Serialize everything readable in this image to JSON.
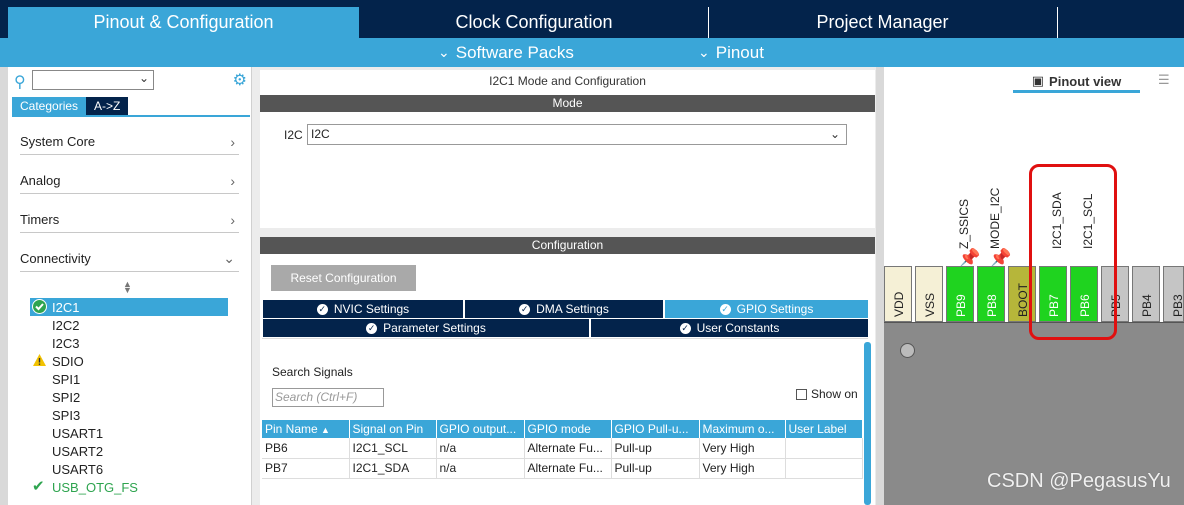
{
  "top_tabs": [
    "Pinout & Configuration",
    "Clock Configuration",
    "Project Manager"
  ],
  "sub_menu": [
    "Software Packs",
    "Pinout"
  ],
  "left": {
    "category_tabs": [
      "Categories",
      "A->Z"
    ],
    "categories": [
      "System Core",
      "Analog",
      "Timers",
      "Connectivity"
    ],
    "items": [
      {
        "label": "I2C1",
        "status": "ok"
      },
      {
        "label": "I2C2",
        "status": ""
      },
      {
        "label": "I2C3",
        "status": ""
      },
      {
        "label": "SDIO",
        "status": "warn"
      },
      {
        "label": "SPI1",
        "status": ""
      },
      {
        "label": "SPI2",
        "status": ""
      },
      {
        "label": "SPI3",
        "status": ""
      },
      {
        "label": "USART1",
        "status": ""
      },
      {
        "label": "USART2",
        "status": ""
      },
      {
        "label": "USART6",
        "status": ""
      },
      {
        "label": "USB_OTG_FS",
        "status": "ok"
      }
    ]
  },
  "middle": {
    "title": "I2C1 Mode and Configuration",
    "mode_header": "Mode",
    "i2c_label": "I2C",
    "i2c_value": "I2C",
    "config_header": "Configuration",
    "reset_button": "Reset Configuration",
    "settings_tabs_row1": [
      "NVIC Settings",
      "DMA Settings",
      "GPIO Settings"
    ],
    "settings_tabs_row2": [
      "Parameter Settings",
      "User Constants"
    ],
    "search_label": "Search Signals",
    "search_placeholder": "Search (Ctrl+F)",
    "show_on": "Show on",
    "table": {
      "headers": [
        "Pin Name",
        "Signal on Pin",
        "GPIO output...",
        "GPIO mode",
        "GPIO Pull-u...",
        "Maximum o...",
        "User Label"
      ],
      "rows": [
        [
          "PB6",
          "I2C1_SCL",
          "n/a",
          "Alternate Fu...",
          "Pull-up",
          "Very High",
          ""
        ],
        [
          "PB7",
          "I2C1_SDA",
          "n/a",
          "Alternate Fu...",
          "Pull-up",
          "Very High",
          ""
        ]
      ]
    }
  },
  "right": {
    "pinout_view": "Pinout view",
    "signals": [
      "Z_SSICS",
      "MODE_I2C",
      "I2C1_SDA",
      "I2C1_SCL"
    ],
    "pins": [
      "VDD",
      "VSS",
      "PB9",
      "PB8",
      "BOOT",
      "PB7",
      "PB6",
      "PB5",
      "PB4",
      "PB3"
    ]
  },
  "watermark": "CSDN @PegasusYu"
}
